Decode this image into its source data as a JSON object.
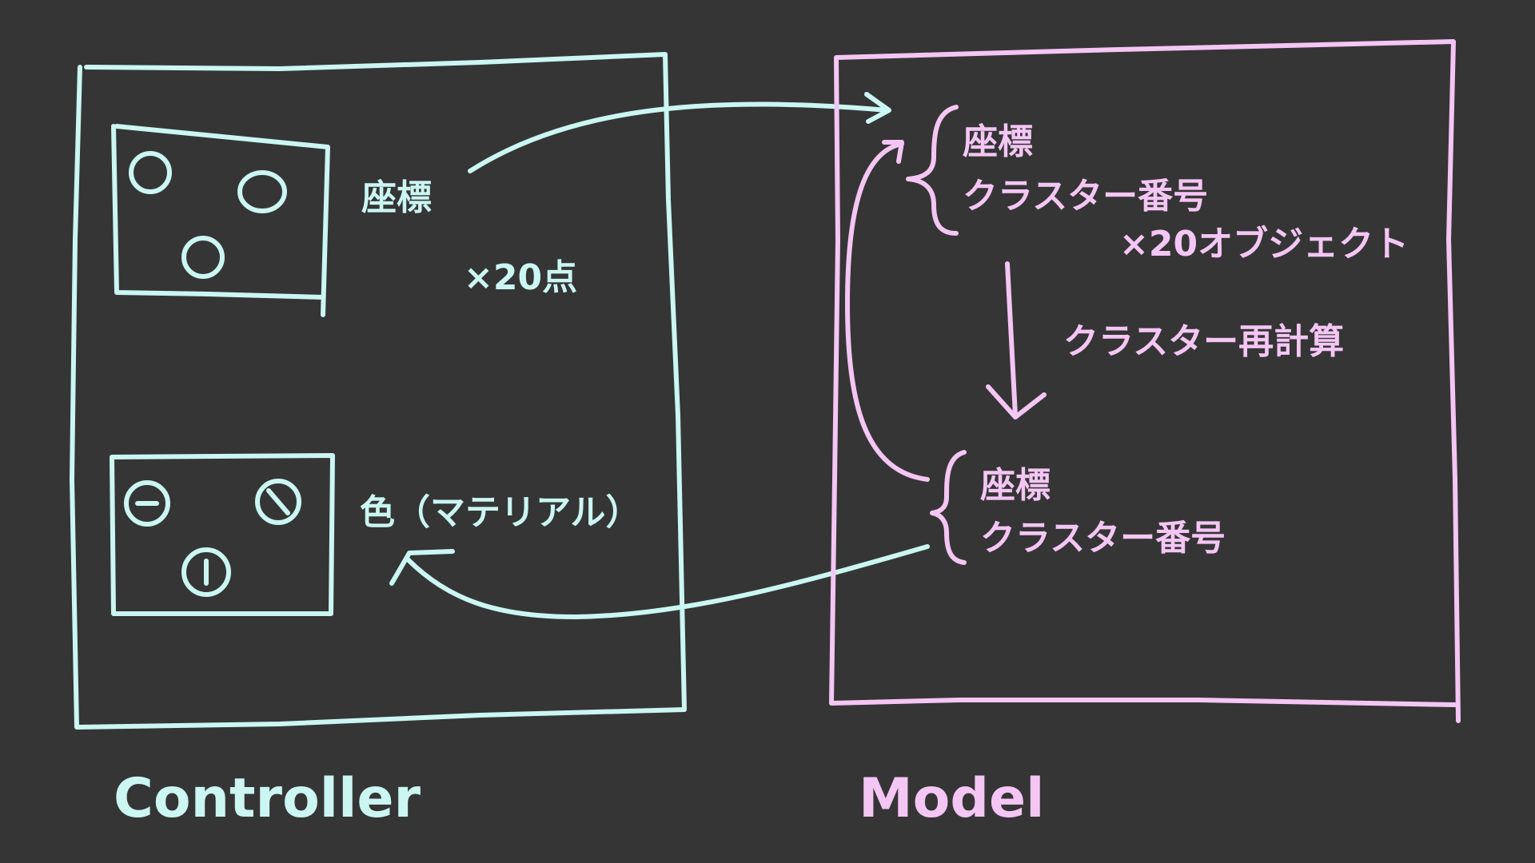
{
  "colors": {
    "background": "#353535",
    "controller_stroke": "#cbf6f2",
    "model_stroke": "#f4c6f4"
  },
  "controller": {
    "caption": "Controller",
    "top_label": "座標",
    "count_label": "×20点",
    "bottom_label": "色（マテリアル）"
  },
  "model": {
    "caption": "Model",
    "group1": {
      "line1": "座標",
      "line2": "クラスター番号",
      "multiplier": "×20オブジェクト"
    },
    "process_label": "クラスター再計算",
    "group2": {
      "line1": "座標",
      "line2": "クラスター番号"
    }
  }
}
